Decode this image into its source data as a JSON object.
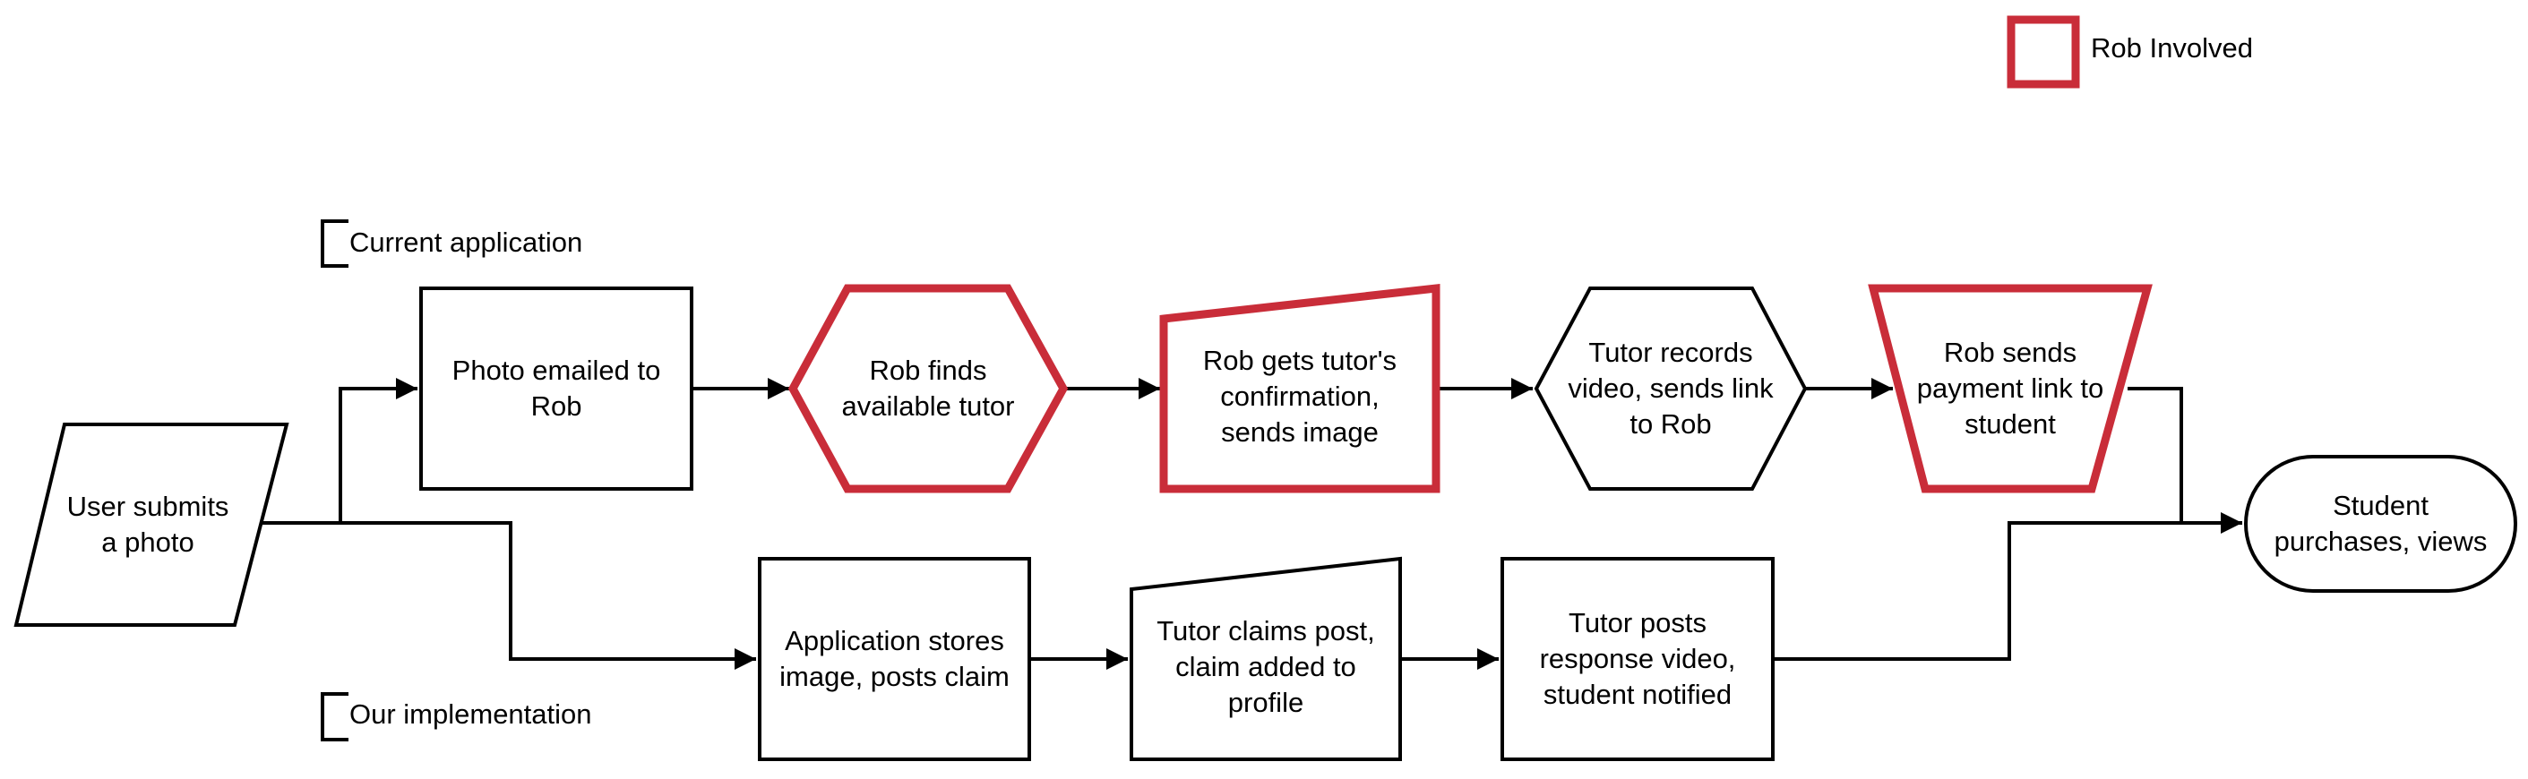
{
  "colors": {
    "rob_involved": "#C92D39",
    "stroke": "#000000",
    "fill": "#FFFFFF"
  },
  "legend": {
    "label": "Rob Involved"
  },
  "lanes": {
    "current": "Current application",
    "ours": "Our implementation"
  },
  "nodes": {
    "user_submits": {
      "label": "User submits\na photo",
      "shape": "parallelogram",
      "rob": false
    },
    "photo_emailed": {
      "label": "Photo emailed to\nRob",
      "shape": "rectangle",
      "rob": false
    },
    "rob_finds": {
      "label": "Rob finds\navailable tutor",
      "shape": "hexagon",
      "rob": true
    },
    "rob_gets_confirmation": {
      "label": "Rob gets tutor's\nconfirmation,\nsends image",
      "shape": "manual-input",
      "rob": true
    },
    "tutor_records": {
      "label": "Tutor records\nvideo, sends link\nto Rob",
      "shape": "hexagon",
      "rob": false
    },
    "rob_sends_payment": {
      "label": "Rob sends\npayment link to\nstudent",
      "shape": "trapezoid",
      "rob": true
    },
    "student_purchases": {
      "label": "Student\npurchases, views",
      "shape": "terminal",
      "rob": false
    },
    "app_stores": {
      "label": "Application stores\nimage, posts claim",
      "shape": "rectangle",
      "rob": false
    },
    "tutor_claims": {
      "label": "Tutor claims post,\nclaim added to\nprofile",
      "shape": "manual-input",
      "rob": false
    },
    "tutor_posts": {
      "label": "Tutor posts\nresponse video,\nstudent notified",
      "shape": "rectangle",
      "rob": false
    }
  },
  "edges": [
    [
      "user_submits",
      "photo_emailed"
    ],
    [
      "photo_emailed",
      "rob_finds"
    ],
    [
      "rob_finds",
      "rob_gets_confirmation"
    ],
    [
      "rob_gets_confirmation",
      "tutor_records"
    ],
    [
      "tutor_records",
      "rob_sends_payment"
    ],
    [
      "rob_sends_payment",
      "student_purchases"
    ],
    [
      "user_submits",
      "app_stores"
    ],
    [
      "app_stores",
      "tutor_claims"
    ],
    [
      "tutor_claims",
      "tutor_posts"
    ],
    [
      "tutor_posts",
      "student_purchases"
    ]
  ]
}
